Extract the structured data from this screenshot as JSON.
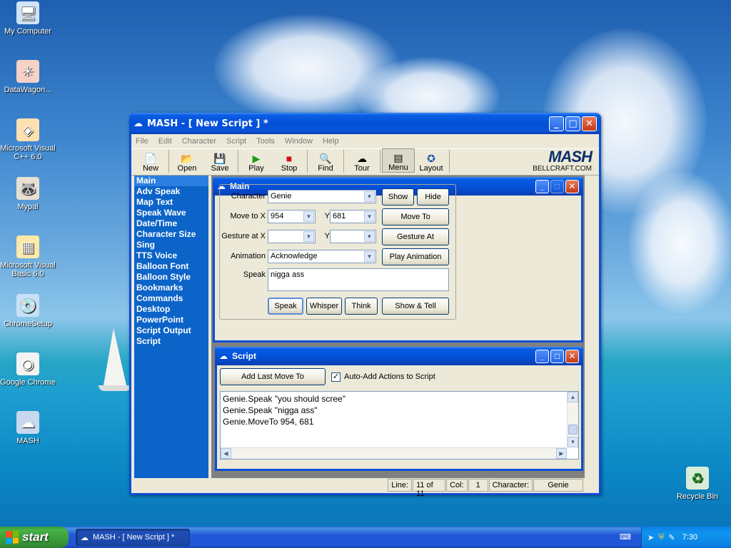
{
  "desktop": {
    "icons": [
      {
        "label": "My Computer",
        "icon": "my-computer-icon",
        "glyph": "🖥"
      },
      {
        "label": "DataWagon...",
        "icon": "datawagon-icon",
        "glyph": "✳"
      },
      {
        "label": "Microsoft Visual C++ 6.0",
        "icon": "visual-cpp-icon",
        "glyph": "◈"
      },
      {
        "label": "Mypal",
        "icon": "mypal-icon",
        "glyph": "🦝"
      },
      {
        "label": "Microsoft Visual Basic 6.0",
        "icon": "visual-basic-icon",
        "glyph": "▦"
      },
      {
        "label": "ChromeSetup",
        "icon": "chrome-setup-icon",
        "glyph": "💿"
      },
      {
        "label": "Google Chrome",
        "icon": "chrome-icon",
        "glyph": "◉"
      },
      {
        "label": "MASH",
        "icon": "mash-icon",
        "glyph": "☁"
      }
    ],
    "recycle_bin": "Recycle Bin"
  },
  "window": {
    "title": "MASH - [ New Script ] *",
    "menu": [
      "File",
      "Edit",
      "Character",
      "Script",
      "Tools",
      "Window",
      "Help"
    ],
    "toolbar": [
      {
        "label": "New",
        "icon": "new-icon",
        "glyph": "📄"
      },
      {
        "label": "Open",
        "icon": "open-icon",
        "glyph": "📂"
      },
      {
        "label": "Save",
        "icon": "save-icon",
        "glyph": "💾"
      },
      {
        "label": "Play",
        "icon": "play-icon",
        "glyph": "▶"
      },
      {
        "label": "Stop",
        "icon": "stop-icon",
        "glyph": "■"
      },
      {
        "label": "Find",
        "icon": "find-icon",
        "glyph": "🔍"
      },
      {
        "label": "Tour",
        "icon": "tour-icon",
        "glyph": "☁"
      },
      {
        "label": "Menu",
        "icon": "menu-icon",
        "glyph": "▤"
      },
      {
        "label": "Layout",
        "icon": "layout-icon",
        "glyph": "✪"
      }
    ],
    "logo": {
      "name": "MASH",
      "url": "BELLCRAFT.COM"
    },
    "nav": [
      "Main",
      "Adv Speak",
      "Map Text",
      "Speak Wave",
      "Date/Time",
      "Character Size",
      "Sing",
      "TTS Voice",
      "Balloon Font",
      "Balloon Style",
      "Bookmarks",
      "Commands",
      "Desktop",
      "PowerPoint",
      "Script Output",
      "Script"
    ],
    "nav_selected": "Main",
    "main_panel": {
      "title": "Main",
      "character_label": "Character",
      "character_value": "Genie",
      "show": "Show",
      "hide": "Hide",
      "move_to_label": "Move to X",
      "move_x": "954",
      "y_label": "Y",
      "move_y": "681",
      "move_to_button": "Move To",
      "gesture_label": "Gesture at X",
      "gesture_x": "",
      "gesture_y_label": "Y",
      "gesture_y": "",
      "gesture_button": "Gesture At",
      "animation_label": "Animation",
      "animation_value": "Acknowledge",
      "play_animation": "Play Animation",
      "speak_label": "Speak",
      "speak_text": "nigga ass",
      "speak_button": "Speak",
      "whisper_button": "Whisper",
      "think_button": "Think",
      "show_tell_button": "Show & Tell"
    },
    "script_panel": {
      "title": "Script",
      "add_last_move": "Add Last Move To",
      "auto_add_label": "Auto-Add Actions to Script",
      "auto_add_checked": "✓",
      "lines": [
        "Genie.Speak \"you should scree\"",
        "Genie.Speak \"nigga ass\"",
        "Genie.MoveTo 954, 681"
      ]
    },
    "status": {
      "line_label": "Line:",
      "line_value": "11 of 11",
      "col_label": "Col:",
      "col_value": "1",
      "character_label": "Character:",
      "character_value": "Genie"
    }
  },
  "taskbar": {
    "start": "start",
    "task": "MASH - [ New Script ] *",
    "clock": "7:30"
  }
}
